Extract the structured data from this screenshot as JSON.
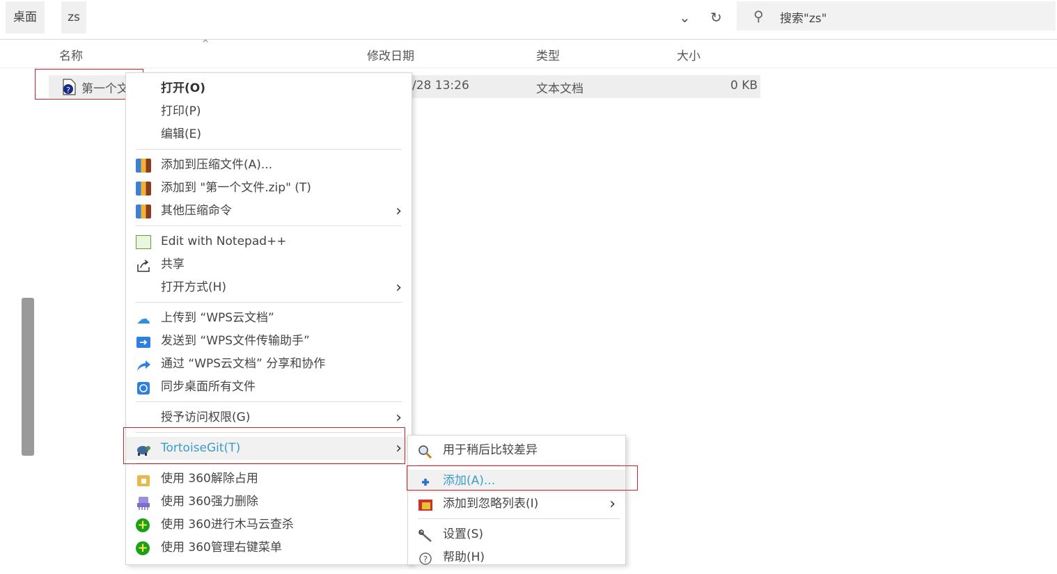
{
  "topbar": {
    "breadcrumbs": [
      "桌面",
      "zs"
    ],
    "dropdown_icon": "chevron-down-icon",
    "refresh_icon": "refresh-icon",
    "search_icon": "search-icon",
    "search_placeholder": "搜索\"zs\""
  },
  "columns": {
    "name": "名称",
    "modified": "修改日期",
    "type": "类型",
    "size": "大小"
  },
  "file": {
    "name": "第一个文",
    "modified": "/28 13:26",
    "type": "文本文档",
    "size": "0 KB",
    "icon": "text-file-icon"
  },
  "menu": {
    "open": "打开(O)",
    "print": "打印(P)",
    "edit": "编辑(E)",
    "add_archive": "添加到压缩文件(A)...",
    "add_zip": "添加到 \"第一个文件.zip\" (T)",
    "other_compress": "其他压缩命令",
    "notepadpp": "Edit with Notepad++",
    "share": "共享",
    "open_with": "打开方式(H)",
    "wps_upload": "上传到 “WPS云文档”",
    "wps_send": "发送到 “WPS文件传输助手”",
    "wps_share": "通过 “WPS云文档” 分享和协作",
    "sync_desktop": "同步桌面所有文件",
    "grant_access": "授予访问权限(G)",
    "tortoisegit": "TortoiseGit(T)",
    "unlock360": "使用 360解除占用",
    "delete360": "使用 360强力删除",
    "scan360": "使用 360进行木马云查杀",
    "manage360": "使用 360管理右键菜单"
  },
  "submenu": {
    "diff_later": "用于稍后比较差异",
    "add": "添加(A)...",
    "ignore": "添加到忽略列表(I)",
    "settings": "设置(S)",
    "help": "帮助(H)"
  },
  "colors": {
    "highlight_box": "#d0202a",
    "teal_text": "#3a9cc8"
  }
}
